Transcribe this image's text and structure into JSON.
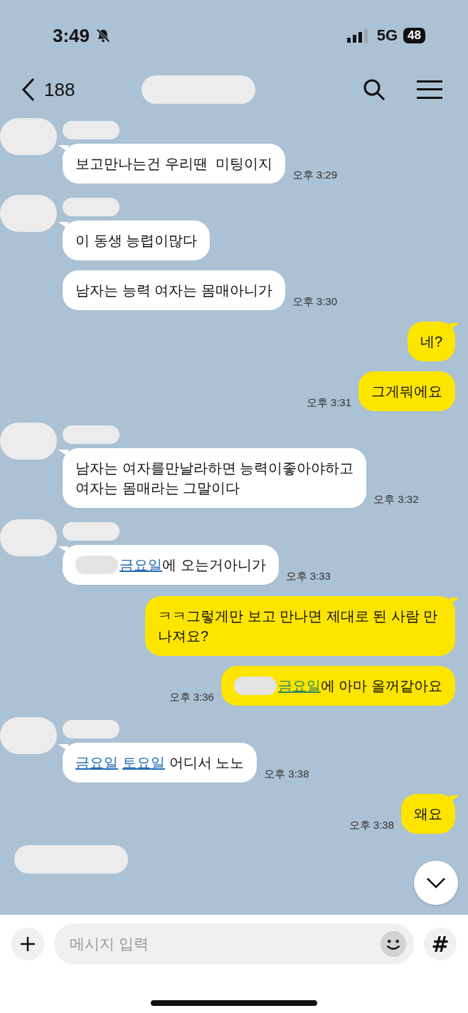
{
  "status_bar": {
    "time": "3:49",
    "network": "5G",
    "battery": "48"
  },
  "header": {
    "back_count": "188"
  },
  "groups": [
    {
      "kind": "received",
      "messages": [
        {
          "segments": [
            {
              "kind": "text",
              "text": "보고만나는건 우리땐  미팅이지"
            }
          ],
          "time": "오후 3:29"
        }
      ]
    },
    {
      "kind": "received",
      "messages": [
        {
          "segments": [
            {
              "kind": "text",
              "text": "이 동생 능렵이많다"
            }
          ]
        },
        {
          "segments": [
            {
              "kind": "text",
              "text": "남자는 능력 여자는 몸매아니가"
            }
          ],
          "time": "오후 3:30"
        }
      ]
    },
    {
      "kind": "sent",
      "messages": [
        {
          "segments": [
            {
              "kind": "text",
              "text": "네?"
            }
          ]
        },
        {
          "segments": [
            {
              "kind": "text",
              "text": "그게뭐에요"
            }
          ],
          "time": "오후 3:31"
        }
      ]
    },
    {
      "kind": "received",
      "messages": [
        {
          "segments": [
            {
              "kind": "text",
              "text": "남자는 여자를만날라하면 능력이좋아야하고\n여자는 몸매라는 그말이다"
            }
          ],
          "time": "오후 3:32"
        }
      ]
    },
    {
      "kind": "received",
      "messages": [
        {
          "redacted_prefix": true,
          "segments": [
            {
              "kind": "link",
              "text": "금요일"
            },
            {
              "kind": "text",
              "text": "에 오는거아니가"
            }
          ],
          "time": "오후 3:33"
        }
      ]
    },
    {
      "kind": "sent",
      "messages": [
        {
          "segments": [
            {
              "kind": "text",
              "text": "ㅋㅋ그렇게만 보고 만나면 제대로 된 사람 만나져요?"
            }
          ]
        },
        {
          "redacted_prefix": true,
          "segments": [
            {
              "kind": "link",
              "text": "금요일"
            },
            {
              "kind": "text",
              "text": "에 아마 올꺼같아요"
            }
          ],
          "time": "오후 3:36"
        }
      ]
    },
    {
      "kind": "received",
      "messages": [
        {
          "segments": [
            {
              "kind": "link",
              "text": "금요일"
            },
            {
              "kind": "link",
              "text": "토요일"
            },
            {
              "kind": "text",
              "text": " 어디서 노노"
            }
          ],
          "time": "오후 3:38"
        }
      ]
    },
    {
      "kind": "sent",
      "messages": [
        {
          "segments": [
            {
              "kind": "text",
              "text": "왜요"
            }
          ],
          "time": "오후 3:38"
        }
      ]
    }
  ],
  "composer": {
    "placeholder": "메시지 입력",
    "hash_key": "#"
  }
}
